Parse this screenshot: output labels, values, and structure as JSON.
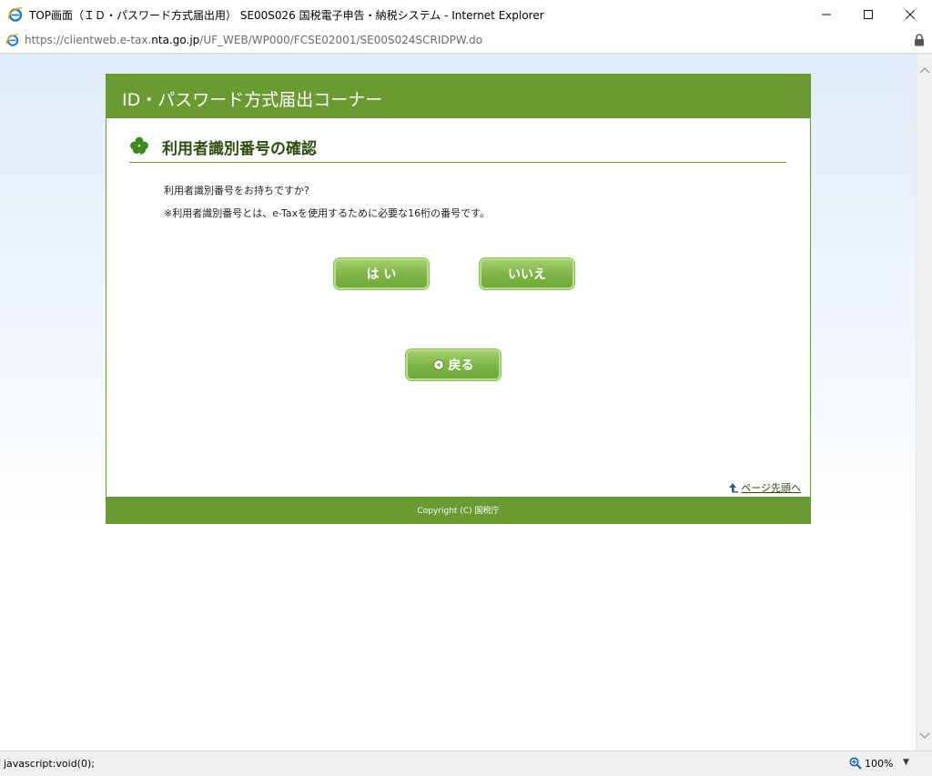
{
  "window": {
    "title": "TOP画面（ＩＤ・パスワード方式届出用） SE00S026 国税電子申告・納税システム - Internet Explorer",
    "minimize": "–",
    "maximize": "☐",
    "close": "✕"
  },
  "address": {
    "prefix": "https://clientweb.e-tax.",
    "host": "nta.go.jp",
    "path": "/UF_WEB/WP000/FCSE02001/SE00S024SCRIDPW.do"
  },
  "page": {
    "corner_title": "ID・パスワード方式届出コーナー",
    "section_title": "利用者識別番号の確認",
    "question": "利用者識別番号をお持ちですか?",
    "note": "※利用者識別番号とは、e-Taxを使用するために必要な16桁の番号です。",
    "yes_label": "は い",
    "no_label": "いいえ",
    "back_label": "戻る",
    "page_top": "ページ先頭へ",
    "copyright": "Copyright (C) 国税庁"
  },
  "statusbar": {
    "status": "javascript:void(0);",
    "zoom": "100%",
    "zoom_dropdown": "▼"
  },
  "colors": {
    "header_green": "#6a9a32",
    "button_green": "#7fb548",
    "title_text": "#2e4d10"
  }
}
